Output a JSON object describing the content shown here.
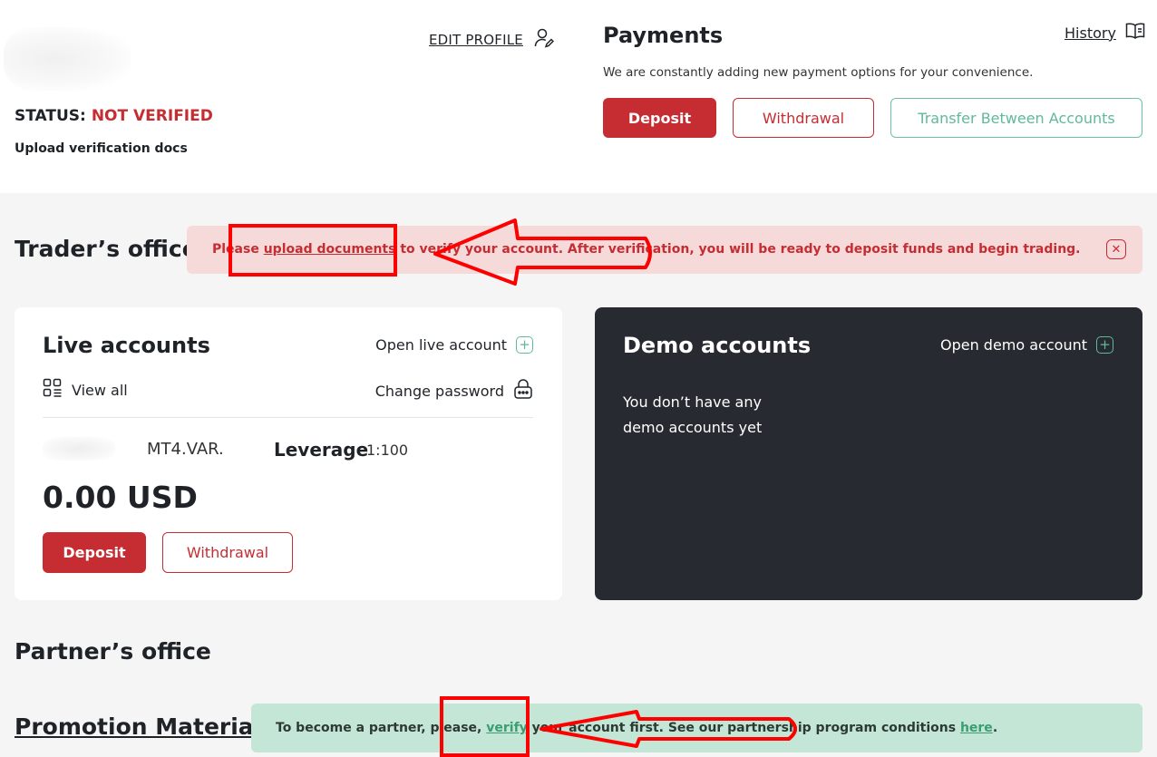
{
  "header": {
    "edit_profile": "EDIT PROFILE",
    "status_label": "STATUS:",
    "status_value": "NOT VERIFIED",
    "upload_docs": "Upload verification docs"
  },
  "payments": {
    "title": "Payments",
    "subtitle": "We are constantly adding new payment options for your convenience.",
    "history": "History",
    "deposit": "Deposit",
    "withdrawal": "Withdrawal",
    "transfer": "Transfer Between Accounts"
  },
  "traders_office": {
    "title": "Trader’s office",
    "alert_pre": "Please ",
    "alert_link": "upload documents",
    "alert_post": " to verify your account. After verification, you will be ready to deposit funds and begin trading."
  },
  "live": {
    "title": "Live accounts",
    "open": "Open live account",
    "view_all": "View all",
    "change_password": "Change password",
    "account_type": "MT4.VAR.",
    "leverage_label": "Leverage",
    "leverage_value": "1:100",
    "balance": "0.00 USD",
    "deposit": "Deposit",
    "withdrawal": "Withdrawal"
  },
  "demo": {
    "title": "Demo accounts",
    "open": "Open demo account",
    "empty": "You don’t have any demo accounts yet"
  },
  "partner": {
    "title": "Partner’s office",
    "promo": "Promotion Materials",
    "notice_pre": "To become a partner, please, ",
    "notice_link": "verify",
    "notice_mid": " your account first. See our partnership program conditions ",
    "notice_link2": "here",
    "notice_end": "."
  },
  "colors": {
    "brand_red": "#c62d32",
    "accent_green": "#5fba98",
    "demo_bg": "#272a30",
    "annotation_red": "#ff0000"
  }
}
